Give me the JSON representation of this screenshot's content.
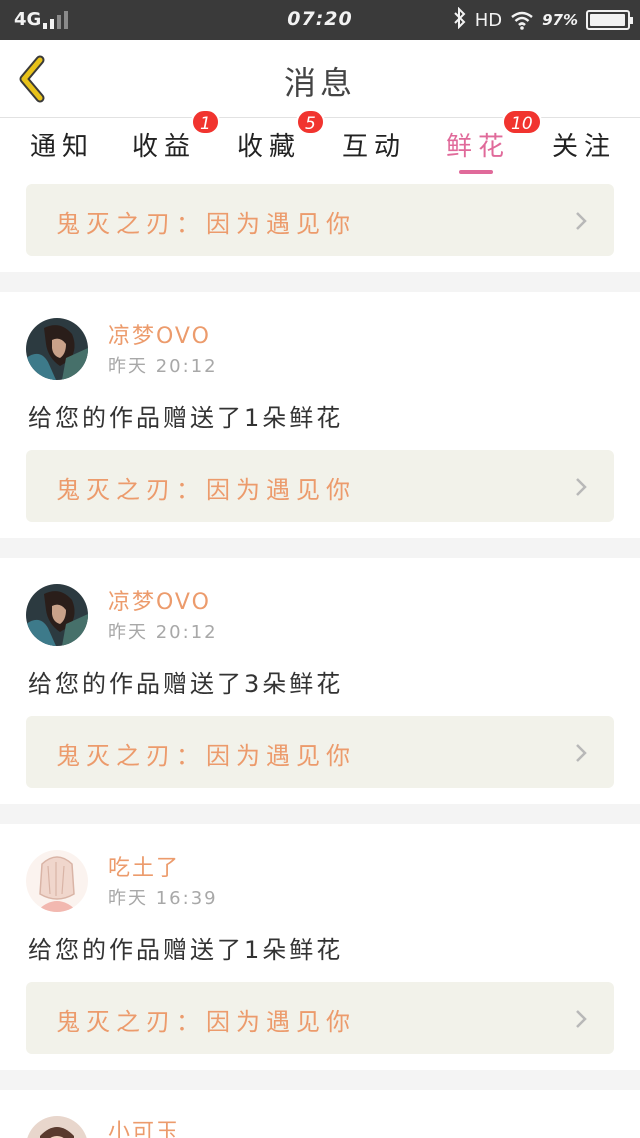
{
  "status_bar": {
    "network": "4G",
    "time": "07:20",
    "hd_label": "HD",
    "battery": "97%",
    "battery_level": 0.97
  },
  "header": {
    "title": "消息"
  },
  "tabs": [
    {
      "label": "通知",
      "badge": ""
    },
    {
      "label": "收益",
      "badge": "1"
    },
    {
      "label": "收藏",
      "badge": "5"
    },
    {
      "label": "互动",
      "badge": ""
    },
    {
      "label": "鲜花",
      "badge": "10",
      "active": true
    },
    {
      "label": "关注",
      "badge": ""
    }
  ],
  "top_work_link": {
    "title": "鬼灭之刃：因为遇见你"
  },
  "messages": [
    {
      "user": "凉梦OVO",
      "time": "昨天 20:12",
      "text": "给您的作品赠送了1朵鲜花",
      "work_title": "鬼灭之刃：因为遇见你"
    },
    {
      "user": "凉梦OVO",
      "time": "昨天 20:12",
      "text": "给您的作品赠送了3朵鲜花",
      "work_title": "鬼灭之刃：因为遇见你"
    },
    {
      "user": "吃土了",
      "time": "昨天 16:39",
      "text": "给您的作品赠送了1朵鲜花",
      "work_title": "鬼灭之刃：因为遇见你"
    },
    {
      "user": "小可玉"
    }
  ],
  "colors": {
    "accent_pink": "#e06a9a",
    "name_orange": "#ec9b6c",
    "badge_red": "#f1342f",
    "back_arrow_yellow": "#e8c21a"
  }
}
